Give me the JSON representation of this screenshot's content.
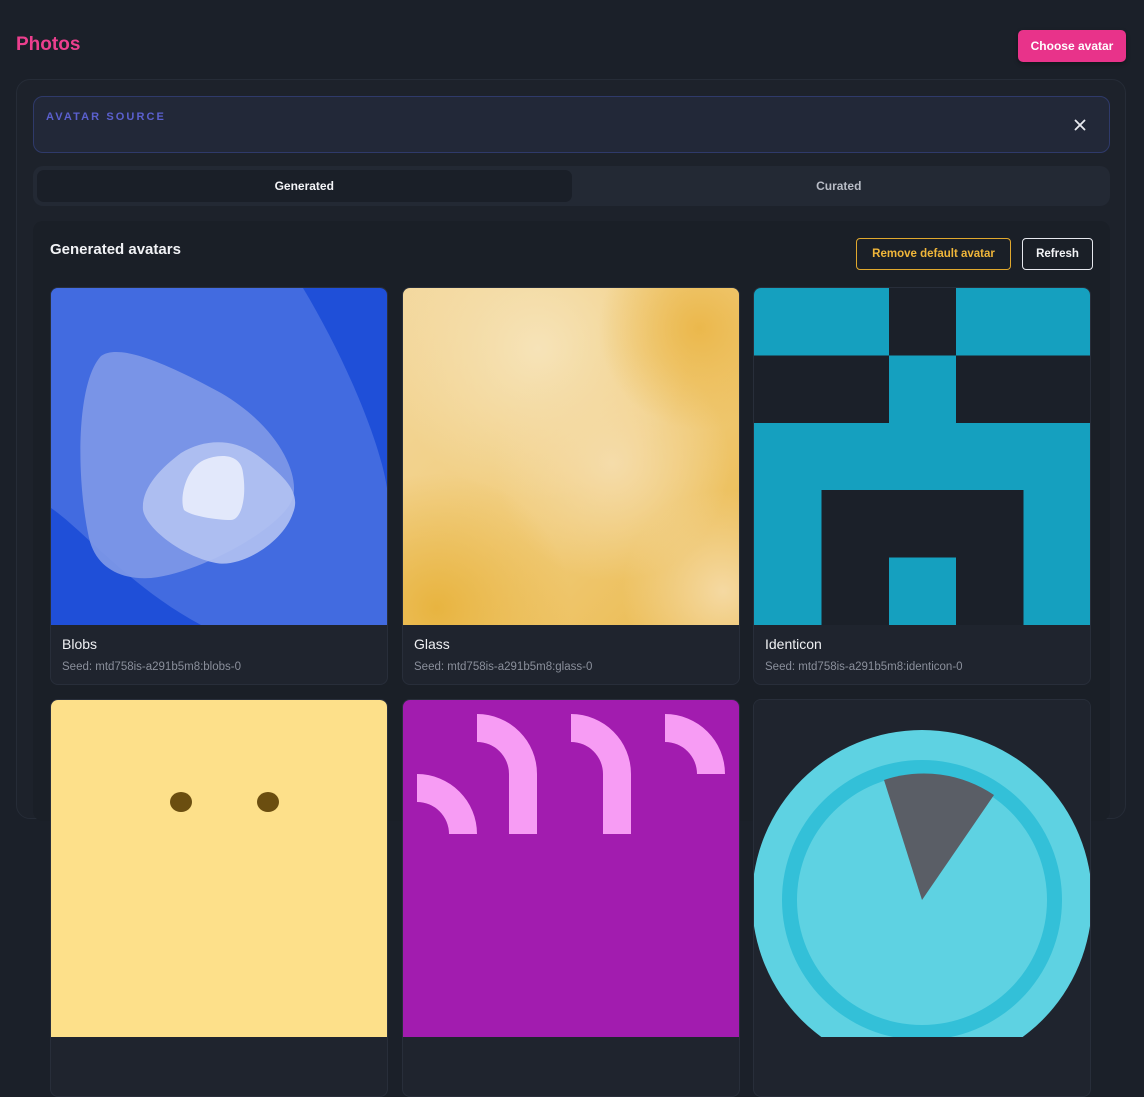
{
  "header": {
    "title": "Photos",
    "choose_label": "Choose avatar"
  },
  "source": {
    "label": "AVATAR SOURCE"
  },
  "tabs": [
    {
      "label": "Generated",
      "active": true
    },
    {
      "label": "Curated",
      "active": false
    }
  ],
  "generated": {
    "title": "Generated avatars",
    "remove_label": "Remove default avatar",
    "refresh_label": "Refresh",
    "cards": [
      {
        "name": "Blobs",
        "seed": "Seed: mtd758is-a291b5m8:blobs-0"
      },
      {
        "name": "Glass",
        "seed": "Seed: mtd758is-a291b5m8:glass-0"
      },
      {
        "name": "Identicon",
        "seed": "Seed: mtd758is-a291b5m8:identicon-0"
      },
      {
        "name": "",
        "seed": ""
      },
      {
        "name": "",
        "seed": ""
      },
      {
        "name": "",
        "seed": ""
      }
    ]
  },
  "colors": {
    "accent": "#e8338a",
    "title": "#ec3f8e",
    "warning": "#f0b63a",
    "source_label": "#5b60cf",
    "blobs_bg": "#4169e1",
    "glass_bg": "#f2d79a",
    "identicon_fg": "#15a0bf",
    "beam_bg": "#fde08a",
    "rings_bg": "#a21caf",
    "sunset_fg": "#5ed2e2"
  },
  "icons": {
    "close": "close-icon"
  }
}
